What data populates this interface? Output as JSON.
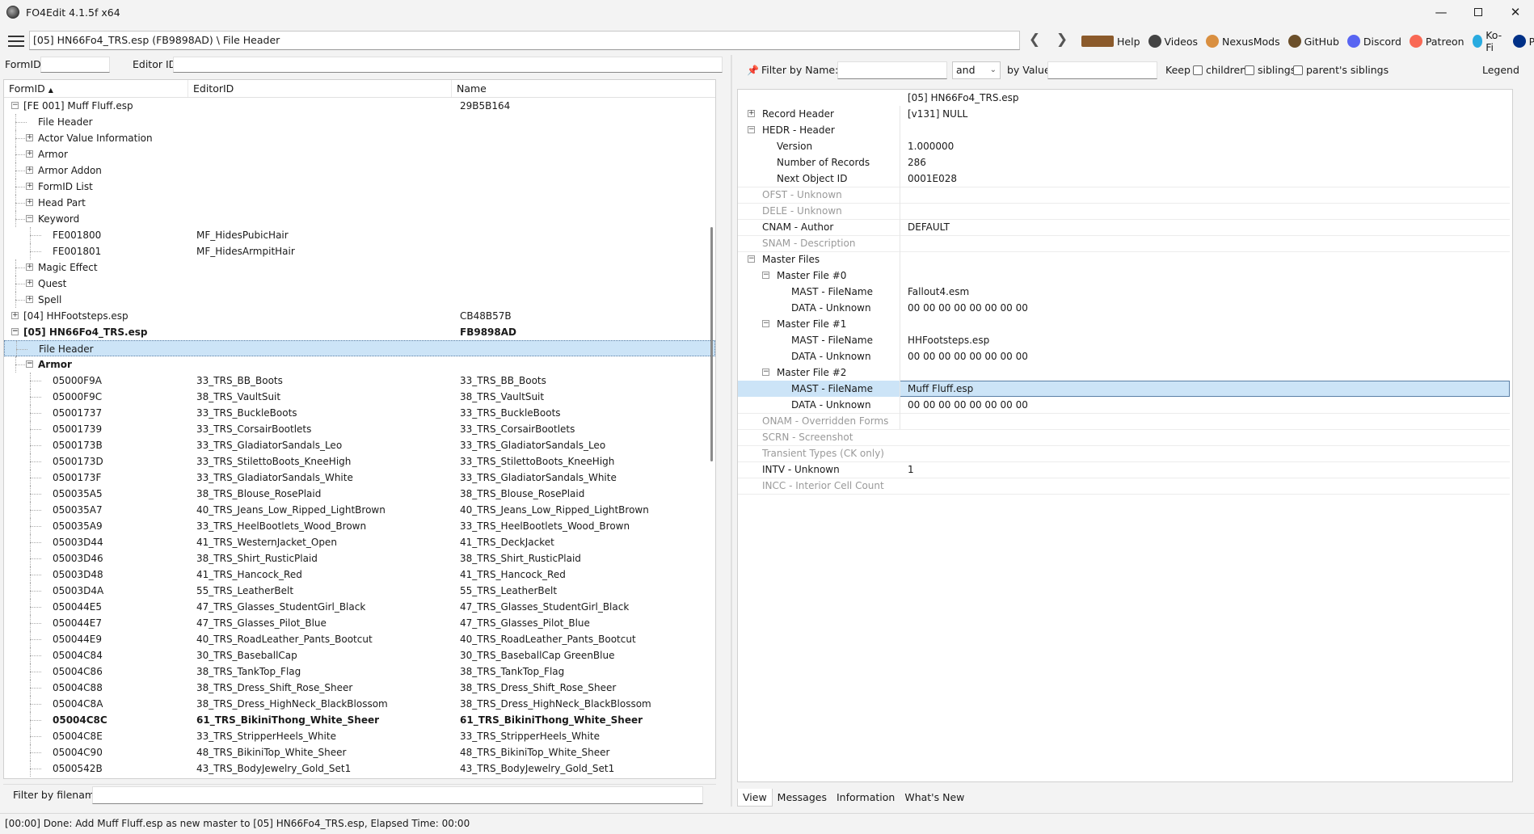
{
  "window": {
    "title": "FO4Edit 4.1.5f x64"
  },
  "toolbar": {
    "path": "[05] HN66Fo4_TRS.esp (FB9898AD) \\ File Header",
    "links": [
      {
        "label": "Help",
        "icon": "book-icon",
        "color": "#8b5a2b"
      },
      {
        "label": "Videos",
        "icon": "video-icon",
        "color": "#444444"
      },
      {
        "label": "NexusMods",
        "icon": "nexus-icon",
        "color": "#d98f40"
      },
      {
        "label": "GitHub",
        "icon": "github-icon",
        "color": "#6b4f2a"
      },
      {
        "label": "Discord",
        "icon": "discord-icon",
        "color": "#5865f2"
      },
      {
        "label": "Patreon",
        "icon": "patreon-icon",
        "color": "#f96854"
      },
      {
        "label": "Ko-Fi",
        "icon": "kofi-icon",
        "color": "#29abe0"
      },
      {
        "label": "PayPal",
        "icon": "paypal-icon",
        "color": "#003087"
      }
    ]
  },
  "left": {
    "formid_label": "FormID",
    "editorid_label": "Editor ID",
    "columns": [
      "FormID",
      "EditorID",
      "Name"
    ],
    "filter_label": "Filter by filename:",
    "rows": [
      {
        "d": 0,
        "t": "[FE 001] Muff Fluff.esp",
        "e": "",
        "n": "29B5B164",
        "x": "-"
      },
      {
        "d": 1,
        "t": "File Header",
        "e": "",
        "n": "",
        "x": ""
      },
      {
        "d": 1,
        "t": "Actor Value Information",
        "e": "",
        "n": "",
        "x": "+"
      },
      {
        "d": 1,
        "t": "Armor",
        "e": "",
        "n": "",
        "x": "+"
      },
      {
        "d": 1,
        "t": "Armor Addon",
        "e": "",
        "n": "",
        "x": "+"
      },
      {
        "d": 1,
        "t": "FormID List",
        "e": "",
        "n": "",
        "x": "+"
      },
      {
        "d": 1,
        "t": "Head Part",
        "e": "",
        "n": "",
        "x": "+"
      },
      {
        "d": 1,
        "t": "Keyword",
        "e": "",
        "n": "",
        "x": "-"
      },
      {
        "d": 2,
        "t": "FE001800",
        "e": "MF_HidesPubicHair",
        "n": "",
        "x": ""
      },
      {
        "d": 2,
        "t": "FE001801",
        "e": "MF_HidesArmpitHair",
        "n": "",
        "x": ""
      },
      {
        "d": 1,
        "t": "Magic Effect",
        "e": "",
        "n": "",
        "x": "+"
      },
      {
        "d": 1,
        "t": "Quest",
        "e": "",
        "n": "",
        "x": "+"
      },
      {
        "d": 1,
        "t": "Spell",
        "e": "",
        "n": "",
        "x": "+"
      },
      {
        "d": 0,
        "t": "[04] HHFootsteps.esp",
        "e": "",
        "n": "CB48B57B",
        "x": "+"
      },
      {
        "d": 0,
        "t": "[05] HN66Fo4_TRS.esp",
        "e": "",
        "n": "FB9898AD",
        "x": "-",
        "b": true
      },
      {
        "d": 1,
        "t": "File Header",
        "e": "",
        "n": "",
        "x": "",
        "s": true
      },
      {
        "d": 1,
        "t": "Armor",
        "e": "",
        "n": "",
        "x": "-",
        "b": true
      },
      {
        "d": 2,
        "t": "05000F9A",
        "e": "33_TRS_BB_Boots",
        "n": "33_TRS_BB_Boots",
        "x": ""
      },
      {
        "d": 2,
        "t": "05000F9C",
        "e": "38_TRS_VaultSuit",
        "n": "38_TRS_VaultSuit",
        "x": ""
      },
      {
        "d": 2,
        "t": "05001737",
        "e": "33_TRS_BuckleBoots",
        "n": "33_TRS_BuckleBoots",
        "x": ""
      },
      {
        "d": 2,
        "t": "05001739",
        "e": "33_TRS_CorsairBootlets",
        "n": "33_TRS_CorsairBootlets",
        "x": ""
      },
      {
        "d": 2,
        "t": "0500173B",
        "e": "33_TRS_GladiatorSandals_Leo",
        "n": "33_TRS_GladiatorSandals_Leo",
        "x": ""
      },
      {
        "d": 2,
        "t": "0500173D",
        "e": "33_TRS_StilettoBoots_KneeHigh",
        "n": "33_TRS_StilettoBoots_KneeHigh",
        "x": ""
      },
      {
        "d": 2,
        "t": "0500173F",
        "e": "33_TRS_GladiatorSandals_White",
        "n": "33_TRS_GladiatorSandals_White",
        "x": ""
      },
      {
        "d": 2,
        "t": "050035A5",
        "e": "38_TRS_Blouse_RosePlaid",
        "n": "38_TRS_Blouse_RosePlaid",
        "x": ""
      },
      {
        "d": 2,
        "t": "050035A7",
        "e": "40_TRS_Jeans_Low_Ripped_LightBrown",
        "n": "40_TRS_Jeans_Low_Ripped_LightBrown",
        "x": ""
      },
      {
        "d": 2,
        "t": "050035A9",
        "e": "33_TRS_HeelBootlets_Wood_Brown",
        "n": "33_TRS_HeelBootlets_Wood_Brown",
        "x": ""
      },
      {
        "d": 2,
        "t": "05003D44",
        "e": "41_TRS_WesternJacket_Open",
        "n": "41_TRS_DeckJacket",
        "x": ""
      },
      {
        "d": 2,
        "t": "05003D46",
        "e": "38_TRS_Shirt_RusticPlaid",
        "n": "38_TRS_Shirt_RusticPlaid",
        "x": ""
      },
      {
        "d": 2,
        "t": "05003D48",
        "e": "41_TRS_Hancock_Red",
        "n": "41_TRS_Hancock_Red",
        "x": ""
      },
      {
        "d": 2,
        "t": "05003D4A",
        "e": "55_TRS_LeatherBelt",
        "n": "55_TRS_LeatherBelt",
        "x": ""
      },
      {
        "d": 2,
        "t": "050044E5",
        "e": "47_TRS_Glasses_StudentGirl_Black",
        "n": "47_TRS_Glasses_StudentGirl_Black",
        "x": ""
      },
      {
        "d": 2,
        "t": "050044E7",
        "e": "47_TRS_Glasses_Pilot_Blue",
        "n": "47_TRS_Glasses_Pilot_Blue",
        "x": ""
      },
      {
        "d": 2,
        "t": "050044E9",
        "e": "40_TRS_RoadLeather_Pants_Bootcut",
        "n": "40_TRS_RoadLeather_Pants_Bootcut",
        "x": ""
      },
      {
        "d": 2,
        "t": "05004C84",
        "e": "30_TRS_BaseballCap",
        "n": "30_TRS_BaseballCap GreenBlue",
        "x": ""
      },
      {
        "d": 2,
        "t": "05004C86",
        "e": "38_TRS_TankTop_Flag",
        "n": "38_TRS_TankTop_Flag",
        "x": ""
      },
      {
        "d": 2,
        "t": "05004C88",
        "e": "38_TRS_Dress_Shift_Rose_Sheer",
        "n": "38_TRS_Dress_Shift_Rose_Sheer",
        "x": ""
      },
      {
        "d": 2,
        "t": "05004C8A",
        "e": "38_TRS_Dress_HighNeck_BlackBlossom",
        "n": "38_TRS_Dress_HighNeck_BlackBlossom",
        "x": ""
      },
      {
        "d": 2,
        "t": "05004C8C",
        "e": "61_TRS_BikiniThong_White_Sheer",
        "n": "61_TRS_BikiniThong_White_Sheer",
        "x": "",
        "b": true
      },
      {
        "d": 2,
        "t": "05004C8E",
        "e": "33_TRS_StripperHeels_White",
        "n": "33_TRS_StripperHeels_White",
        "x": ""
      },
      {
        "d": 2,
        "t": "05004C90",
        "e": "48_TRS_BikiniTop_White_Sheer",
        "n": "48_TRS_BikiniTop_White_Sheer",
        "x": ""
      },
      {
        "d": 2,
        "t": "0500542B",
        "e": "43_TRS_BodyJewelry_Gold_Set1",
        "n": "43_TRS_BodyJewelry_Gold_Set1",
        "x": ""
      }
    ]
  },
  "right": {
    "filter_name_label": "Filter by Name:",
    "and_value": "and",
    "by_value_label": "by Value:",
    "keep_label": "Keep",
    "children_label": "children",
    "siblings_label": "siblings",
    "parents_label": "parent's siblings",
    "legend_label": "Legend",
    "file_col": "[05] HN66Fo4_TRS.esp",
    "records": [
      {
        "d": 0,
        "l": "Record Header",
        "v": "[v131] NULL",
        "x": "+"
      },
      {
        "d": 0,
        "l": "HEDR - Header",
        "v": "",
        "x": "-"
      },
      {
        "d": 1,
        "l": "Version",
        "v": "1.000000",
        "x": ""
      },
      {
        "d": 1,
        "l": "Number of Records",
        "v": "286",
        "x": ""
      },
      {
        "d": 1,
        "l": "Next Object ID",
        "v": "0001E028",
        "x": ""
      },
      {
        "d": 0,
        "l": "OFST - Unknown",
        "v": "",
        "x": "",
        "dim": true
      },
      {
        "d": 0,
        "l": "DELE - Unknown",
        "v": "",
        "x": "",
        "dim": true
      },
      {
        "d": 0,
        "l": "CNAM - Author",
        "v": "DEFAULT",
        "x": ""
      },
      {
        "d": 0,
        "l": "SNAM - Description",
        "v": "",
        "x": "",
        "dim": true
      },
      {
        "d": 0,
        "l": "Master Files",
        "v": "",
        "x": "-"
      },
      {
        "d": 1,
        "l": "Master File #0",
        "v": "",
        "x": "-"
      },
      {
        "d": 2,
        "l": "MAST - FileName",
        "v": "Fallout4.esm",
        "x": ""
      },
      {
        "d": 2,
        "l": "DATA - Unknown",
        "v": "00 00 00 00 00 00 00 00",
        "x": ""
      },
      {
        "d": 1,
        "l": "Master File #1",
        "v": "",
        "x": "-"
      },
      {
        "d": 2,
        "l": "MAST - FileName",
        "v": "HHFootsteps.esp",
        "x": ""
      },
      {
        "d": 2,
        "l": "DATA - Unknown",
        "v": "00 00 00 00 00 00 00 00",
        "x": ""
      },
      {
        "d": 1,
        "l": "Master File #2",
        "v": "",
        "x": "-"
      },
      {
        "d": 2,
        "l": "MAST - FileName",
        "v": "Muff Fluff.esp",
        "x": "",
        "s": true
      },
      {
        "d": 2,
        "l": "DATA - Unknown",
        "v": "00 00 00 00 00 00 00 00",
        "x": ""
      },
      {
        "d": 0,
        "l": "ONAM - Overridden Forms",
        "v": "",
        "x": "",
        "dim": true
      },
      {
        "d": 0,
        "l": "SCRN - Screenshot",
        "v": "",
        "x": "",
        "dim": true
      },
      {
        "d": 0,
        "l": "Transient Types (CK only)",
        "v": "",
        "x": "",
        "dim": true
      },
      {
        "d": 0,
        "l": "INTV - Unknown",
        "v": "1",
        "x": ""
      },
      {
        "d": 0,
        "l": "INCC - Interior Cell Count",
        "v": "",
        "x": "",
        "dim": true
      }
    ],
    "tabs": [
      "View",
      "Messages",
      "Information",
      "What's New"
    ]
  },
  "status": "[00:00] Done: Add Muff Fluff.esp as new master to [05] HN66Fo4_TRS.esp, Elapsed Time: 00:00"
}
